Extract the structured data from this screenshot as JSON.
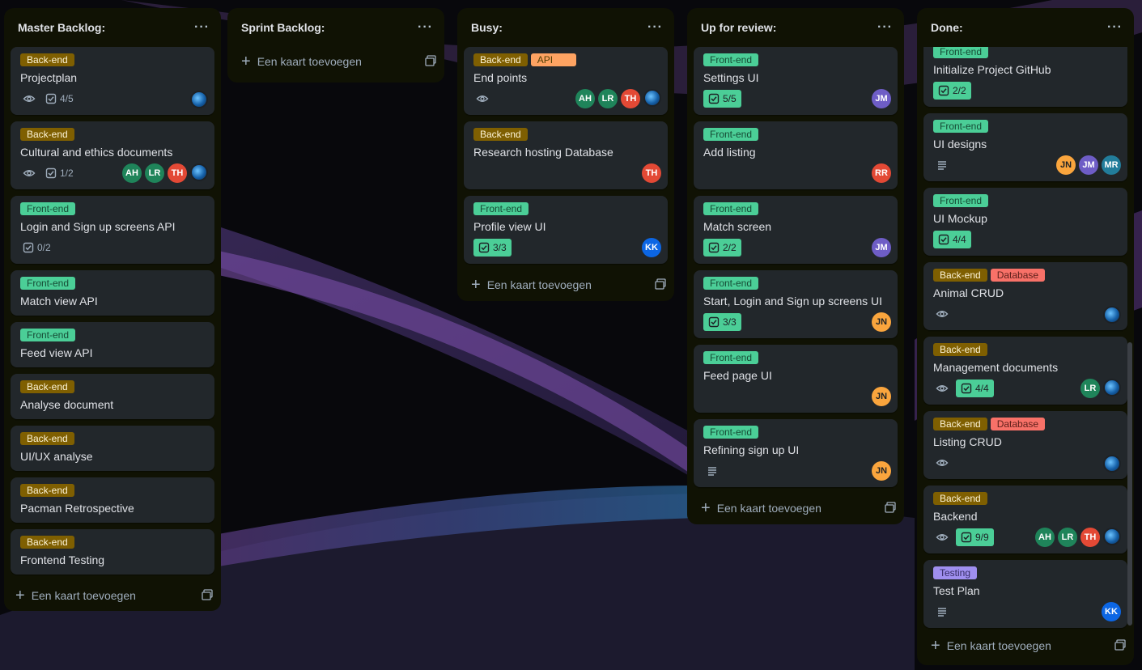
{
  "add_card_label": "Een kaart toevoegen",
  "lists": [
    {
      "title": "Master Backlog:",
      "cards": [
        {
          "labels": [
            {
              "text": "Back-end",
              "type": "backend"
            }
          ],
          "title": "Projectplan",
          "watch": true,
          "checklist": "4/5",
          "checklist_done": false,
          "members": [
            {
              "type": "globe"
            }
          ]
        },
        {
          "labels": [
            {
              "text": "Back-end",
              "type": "backend"
            }
          ],
          "title": "Cultural and ethics documents",
          "watch": true,
          "checklist": "1/2",
          "checklist_done": false,
          "members": [
            {
              "initials": "AH",
              "color": "green"
            },
            {
              "initials": "LR",
              "color": "green"
            },
            {
              "initials": "TH",
              "color": "red"
            },
            {
              "type": "globe"
            }
          ]
        },
        {
          "labels": [
            {
              "text": "Front-end",
              "type": "frontend"
            }
          ],
          "title": "Login and Sign up screens API",
          "checklist": "0/2",
          "checklist_done": false,
          "members": []
        },
        {
          "labels": [
            {
              "text": "Front-end",
              "type": "frontend"
            }
          ],
          "title": "Match view API",
          "members": []
        },
        {
          "labels": [
            {
              "text": "Front-end",
              "type": "frontend"
            }
          ],
          "title": "Feed view API",
          "members": []
        },
        {
          "labels": [
            {
              "text": "Back-end",
              "type": "backend"
            }
          ],
          "title": "Analyse document",
          "members": []
        },
        {
          "labels": [
            {
              "text": "Back-end",
              "type": "backend"
            }
          ],
          "title": "UI/UX analyse",
          "members": []
        },
        {
          "labels": [
            {
              "text": "Back-end",
              "type": "backend"
            }
          ],
          "title": "Pacman Retrospective",
          "members": []
        },
        {
          "labels": [
            {
              "text": "Back-end",
              "type": "backend"
            }
          ],
          "title": "Frontend Testing",
          "members": []
        }
      ]
    },
    {
      "title": "Sprint Backlog:",
      "cards": []
    },
    {
      "title": "Busy:",
      "cards": [
        {
          "labels": [
            {
              "text": "Back-end",
              "type": "backend"
            },
            {
              "text": "API",
              "type": "api"
            }
          ],
          "title": "End points",
          "watch": true,
          "members": [
            {
              "initials": "AH",
              "color": "green"
            },
            {
              "initials": "LR",
              "color": "green"
            },
            {
              "initials": "TH",
              "color": "red"
            },
            {
              "type": "globe"
            }
          ]
        },
        {
          "labels": [
            {
              "text": "Back-end",
              "type": "backend"
            }
          ],
          "title": "Research hosting Database",
          "members": [
            {
              "initials": "TH",
              "color": "red"
            }
          ]
        },
        {
          "labels": [
            {
              "text": "Front-end",
              "type": "frontend"
            }
          ],
          "title": "Profile view UI",
          "checklist": "3/3",
          "checklist_done": true,
          "members": [
            {
              "initials": "KK",
              "color": "blue"
            }
          ]
        }
      ]
    },
    {
      "title": "Up for review:",
      "cards": [
        {
          "labels": [
            {
              "text": "Front-end",
              "type": "frontend"
            }
          ],
          "title": "Settings UI",
          "checklist": "5/5",
          "checklist_done": true,
          "members": [
            {
              "initials": "JM",
              "color": "purple"
            }
          ]
        },
        {
          "labels": [
            {
              "text": "Front-end",
              "type": "frontend"
            }
          ],
          "title": "Add listing",
          "members": [
            {
              "initials": "RR",
              "color": "red"
            }
          ]
        },
        {
          "labels": [
            {
              "text": "Front-end",
              "type": "frontend"
            }
          ],
          "title": "Match screen",
          "checklist": "2/2",
          "checklist_done": true,
          "members": [
            {
              "initials": "JM",
              "color": "purple"
            }
          ]
        },
        {
          "labels": [
            {
              "text": "Front-end",
              "type": "frontend"
            }
          ],
          "title": "Start, Login and Sign up screens UI",
          "checklist": "3/3",
          "checklist_done": true,
          "members": [
            {
              "initials": "JN",
              "color": "orange"
            }
          ]
        },
        {
          "labels": [
            {
              "text": "Front-end",
              "type": "frontend"
            }
          ],
          "title": "Feed page UI",
          "members": [
            {
              "initials": "JN",
              "color": "orange"
            }
          ]
        },
        {
          "labels": [
            {
              "text": "Front-end",
              "type": "frontend"
            }
          ],
          "title": "Refining sign up UI",
          "description": true,
          "members": [
            {
              "initials": "JN",
              "color": "orange"
            }
          ]
        }
      ]
    },
    {
      "title": "Done:",
      "cards": [
        {
          "labels": [
            {
              "text": "Front-end",
              "type": "frontend"
            }
          ],
          "title": "Initialize Project GitHub",
          "checklist": "2/2",
          "checklist_done": true,
          "members": []
        },
        {
          "labels": [
            {
              "text": "Front-end",
              "type": "frontend"
            }
          ],
          "title": "UI designs",
          "description": true,
          "members": [
            {
              "initials": "JN",
              "color": "orange"
            },
            {
              "initials": "JM",
              "color": "purple"
            },
            {
              "initials": "MR",
              "color": "teal"
            }
          ]
        },
        {
          "labels": [
            {
              "text": "Front-end",
              "type": "frontend"
            }
          ],
          "title": "UI Mockup",
          "checklist": "4/4",
          "checklist_done": true,
          "members": []
        },
        {
          "labels": [
            {
              "text": "Back-end",
              "type": "backend"
            },
            {
              "text": "Database",
              "type": "database"
            }
          ],
          "title": "Animal CRUD",
          "watch": true,
          "members": [
            {
              "type": "globe"
            }
          ]
        },
        {
          "labels": [
            {
              "text": "Back-end",
              "type": "backend"
            }
          ],
          "title": "Management documents",
          "watch": true,
          "checklist": "4/4",
          "checklist_done": true,
          "members": [
            {
              "initials": "LR",
              "color": "green"
            },
            {
              "type": "globe"
            }
          ]
        },
        {
          "labels": [
            {
              "text": "Back-end",
              "type": "backend"
            },
            {
              "text": "Database",
              "type": "database"
            }
          ],
          "title": "Listing CRUD",
          "watch": true,
          "members": [
            {
              "type": "globe"
            }
          ]
        },
        {
          "labels": [
            {
              "text": "Back-end",
              "type": "backend"
            }
          ],
          "title": "Backend",
          "watch": true,
          "checklist": "9/9",
          "checklist_done": true,
          "members": [
            {
              "initials": "AH",
              "color": "green"
            },
            {
              "initials": "LR",
              "color": "green"
            },
            {
              "initials": "TH",
              "color": "red"
            },
            {
              "type": "globe"
            }
          ]
        },
        {
          "labels": [
            {
              "text": "Testing",
              "type": "testing"
            }
          ],
          "title": "Test Plan",
          "description": true,
          "members": [
            {
              "initials": "KK",
              "color": "blue"
            }
          ]
        }
      ]
    }
  ]
}
